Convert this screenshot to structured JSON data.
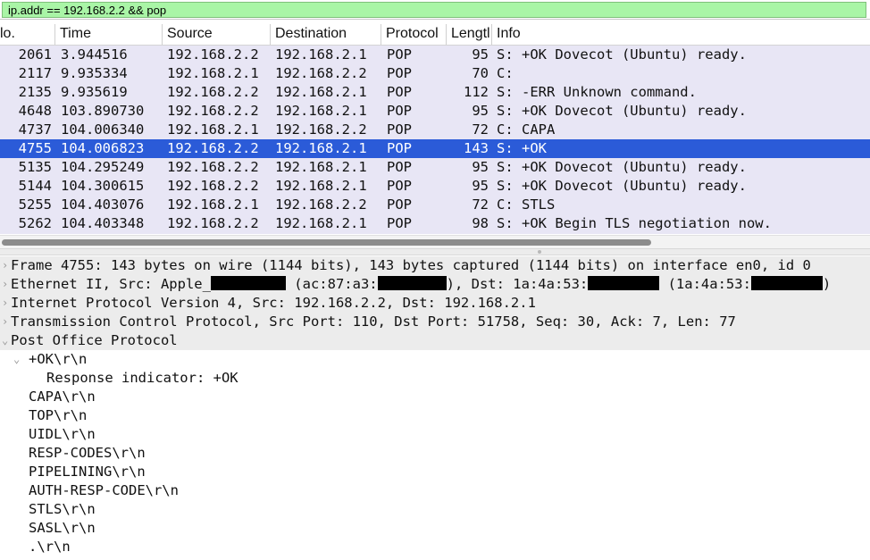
{
  "filter": {
    "value": "ip.addr == 192.168.2.2 && pop"
  },
  "columns": [
    "lo.",
    "Time",
    "Source",
    "Destination",
    "Protocol",
    "Lengtl",
    "Info"
  ],
  "packets": [
    {
      "no": "2061",
      "time": "3.944516",
      "src": "192.168.2.2",
      "dst": "192.168.2.1",
      "proto": "POP",
      "len": "95",
      "info": "S: +OK Dovecot (Ubuntu) ready."
    },
    {
      "no": "2117",
      "time": "9.935334",
      "src": "192.168.2.1",
      "dst": "192.168.2.2",
      "proto": "POP",
      "len": "70",
      "info": "C:"
    },
    {
      "no": "2135",
      "time": "9.935619",
      "src": "192.168.2.2",
      "dst": "192.168.2.1",
      "proto": "POP",
      "len": "112",
      "info": "S: -ERR Unknown command."
    },
    {
      "no": "4648",
      "time": "103.890730",
      "src": "192.168.2.2",
      "dst": "192.168.2.1",
      "proto": "POP",
      "len": "95",
      "info": "S: +OK Dovecot (Ubuntu) ready."
    },
    {
      "no": "4737",
      "time": "104.006340",
      "src": "192.168.2.1",
      "dst": "192.168.2.2",
      "proto": "POP",
      "len": "72",
      "info": "C: CAPA"
    },
    {
      "no": "4755",
      "time": "104.006823",
      "src": "192.168.2.2",
      "dst": "192.168.2.1",
      "proto": "POP",
      "len": "143",
      "info": "S: +OK",
      "selected": true
    },
    {
      "no": "5135",
      "time": "104.295249",
      "src": "192.168.2.2",
      "dst": "192.168.2.1",
      "proto": "POP",
      "len": "95",
      "info": "S: +OK Dovecot (Ubuntu) ready."
    },
    {
      "no": "5144",
      "time": "104.300615",
      "src": "192.168.2.2",
      "dst": "192.168.2.1",
      "proto": "POP",
      "len": "95",
      "info": "S: +OK Dovecot (Ubuntu) ready."
    },
    {
      "no": "5255",
      "time": "104.403076",
      "src": "192.168.2.1",
      "dst": "192.168.2.2",
      "proto": "POP",
      "len": "72",
      "info": "C: STLS"
    },
    {
      "no": "5262",
      "time": "104.403348",
      "src": "192.168.2.2",
      "dst": "192.168.2.1",
      "proto": "POP",
      "len": "98",
      "info": "S: +OK Begin TLS negotiation now."
    }
  ],
  "details": {
    "frame": "Frame 4755: 143 bytes on wire (1144 bits), 143 bytes captured (1144 bits) on interface en0, id 0",
    "ethernet": {
      "p1": "Ethernet II, Src: Apple_",
      "p2": " (ac:87:a3:",
      "p3": "), Dst: 1a:4a:53:",
      "p4": " (1a:4a:53:",
      "p5": ")"
    },
    "ip": "Internet Protocol Version 4, Src: 192.168.2.2, Dst: 192.168.2.1",
    "tcp": "Transmission Control Protocol, Src Port: 110, Dst Port: 51758, Seq: 30, Ack: 7, Len: 77",
    "pop": "Post Office Protocol",
    "ok_line": "+OK\\r\\n",
    "resp_indicator": "Response indicator: +OK",
    "lines": [
      "CAPA\\r\\n",
      "TOP\\r\\n",
      "UIDL\\r\\n",
      "RESP-CODES\\r\\n",
      "PIPELINING\\r\\n",
      "AUTH-RESP-CODE\\r\\n",
      "STLS\\r\\n",
      "SASL\\r\\n",
      ".\\r\\n"
    ]
  },
  "colors": {
    "filter_bg": "#a9f5a6",
    "list_bg": "#e8e6f5",
    "selected_bg": "#2b5bd8",
    "detail_header_bg": "#ececec"
  },
  "icons": {
    "collapsed": "chevron-right-icon",
    "expanded": "chevron-down-icon"
  }
}
